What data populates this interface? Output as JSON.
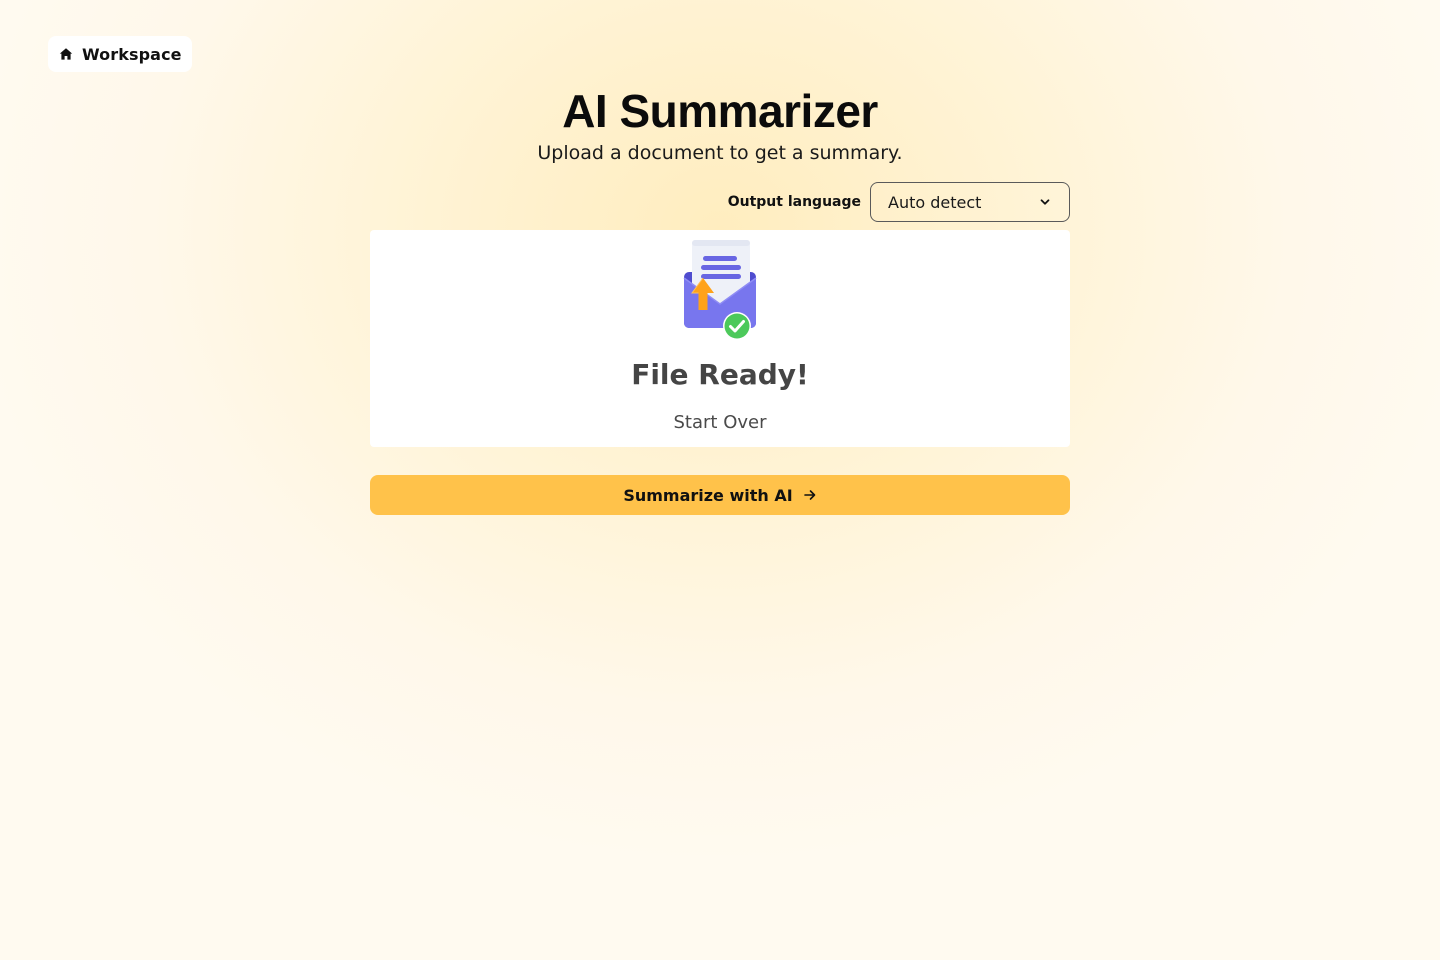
{
  "nav": {
    "home_icon": "home-icon",
    "home_label": "Workspace"
  },
  "header": {
    "title": "AI Summarizer",
    "subtitle": "Upload a document to get a summary."
  },
  "language": {
    "label": "Output language",
    "selected": "Auto detect",
    "dropdown_icon": "chevron-down-icon"
  },
  "upload": {
    "illustration_icon": "file-upload-success-icon",
    "status": "File Ready!",
    "start_over": "Start Over"
  },
  "action": {
    "summarize_label": "Summarize with AI",
    "arrow_icon": "arrow-right-icon"
  },
  "colors": {
    "accent": "#ffc24a",
    "background": "#fff4d8",
    "card": "#ffffff",
    "success": "#4cc95b",
    "doc_blue": "#6f6ee6",
    "upload_orange": "#ffa21a"
  }
}
